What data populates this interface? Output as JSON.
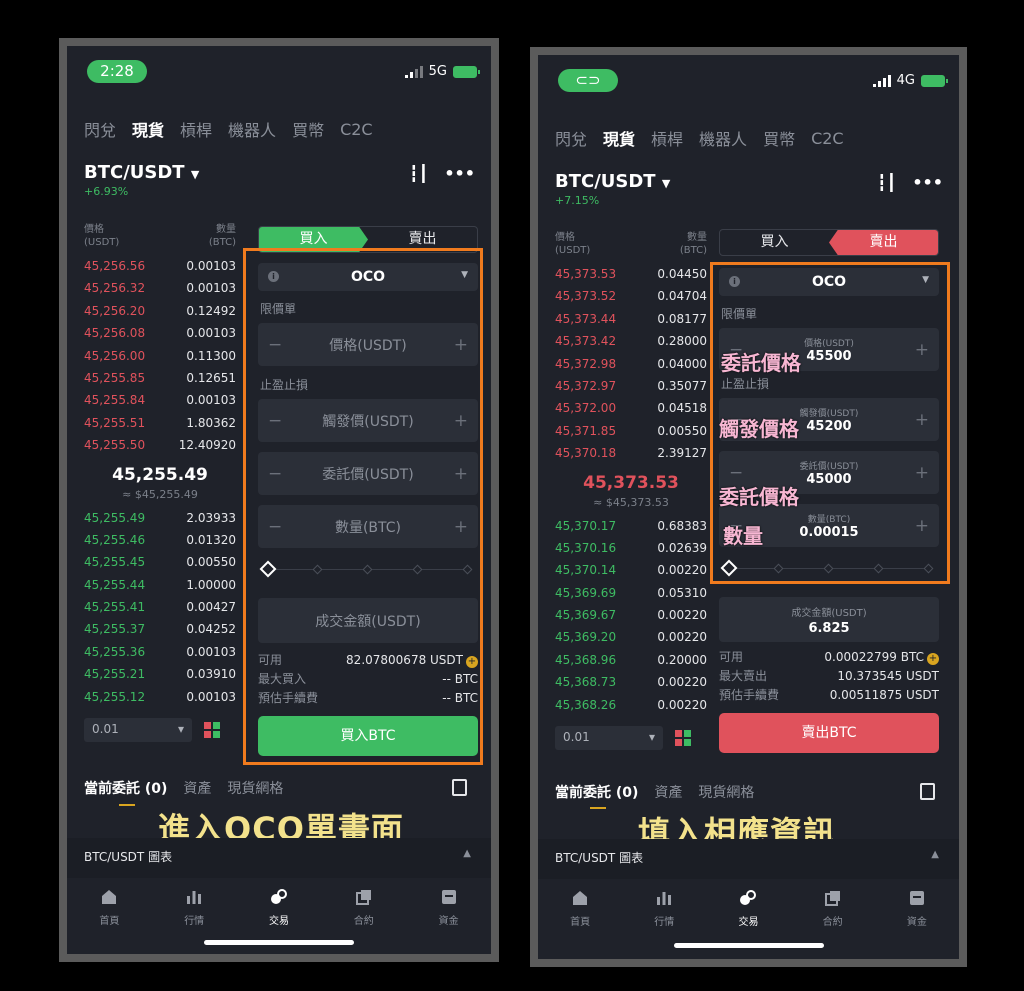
{
  "left": {
    "status": {
      "time": "2:28",
      "network": "5G"
    },
    "tabs": [
      "閃兌",
      "現貨",
      "槓桿",
      "機器人",
      "買幣",
      "C2C"
    ],
    "pair": {
      "name": "BTC/USDT",
      "change": "+6.93%"
    },
    "orderbook": {
      "head_price": "價格",
      "head_price_unit": "(USDT)",
      "head_qty": "數量",
      "head_qty_unit": "(BTC)",
      "asks": [
        [
          "45,256.56",
          "0.00103"
        ],
        [
          "45,256.32",
          "0.00103"
        ],
        [
          "45,256.20",
          "0.12492"
        ],
        [
          "45,256.08",
          "0.00103"
        ],
        [
          "45,256.00",
          "0.11300"
        ],
        [
          "45,255.85",
          "0.12651"
        ],
        [
          "45,255.84",
          "0.00103"
        ],
        [
          "45,255.51",
          "1.80362"
        ],
        [
          "45,255.50",
          "12.40920"
        ]
      ],
      "last_price": "45,255.49",
      "last_price_fiat": "≈ $45,255.49",
      "bids": [
        [
          "45,255.49",
          "2.03933"
        ],
        [
          "45,255.46",
          "0.01320"
        ],
        [
          "45,255.45",
          "0.00550"
        ],
        [
          "45,255.44",
          "1.00000"
        ],
        [
          "45,255.41",
          "0.00427"
        ],
        [
          "45,255.37",
          "0.04252"
        ],
        [
          "45,255.36",
          "0.00103"
        ],
        [
          "45,255.21",
          "0.03910"
        ],
        [
          "45,255.12",
          "0.00103"
        ]
      ],
      "precision": "0.01"
    },
    "trade": {
      "buy_label": "買入",
      "sell_label": "賣出",
      "order_type": "OCO",
      "limit_label": "限價單",
      "price_placeholder": "價格(USDT)",
      "tpsl_label": "止盈止損",
      "trigger_placeholder": "觸發價(USDT)",
      "entrust_placeholder": "委託價(USDT)",
      "qty_placeholder": "數量(BTC)",
      "amount_placeholder": "成交金額(USDT)",
      "available_label": "可用",
      "available_value": "82.07800678 USDT",
      "max_label": "最大買入",
      "max_value": "-- BTC",
      "fee_label": "預估手續費",
      "fee_value": "-- BTC",
      "action": "買入BTC"
    },
    "orders_tabs": [
      "當前委託 (0)",
      "資產",
      "現貨網格"
    ],
    "caption": "進入OCO單畫面",
    "chart_label": "BTC/USDT 圖表",
    "nav": [
      "首頁",
      "行情",
      "交易",
      "合約",
      "資金"
    ]
  },
  "right": {
    "status": {
      "network": "4G"
    },
    "tabs": [
      "閃兌",
      "現貨",
      "槓桿",
      "機器人",
      "買幣",
      "C2C"
    ],
    "pair": {
      "name": "BTC/USDT",
      "change": "+7.15%"
    },
    "orderbook": {
      "head_price": "價格",
      "head_price_unit": "(USDT)",
      "head_qty": "數量",
      "head_qty_unit": "(BTC)",
      "asks": [
        [
          "45,373.53",
          "0.04450"
        ],
        [
          "45,373.52",
          "0.04704"
        ],
        [
          "45,373.44",
          "0.08177"
        ],
        [
          "45,373.42",
          "0.28000"
        ],
        [
          "45,372.98",
          "0.04000"
        ],
        [
          "45,372.97",
          "0.35077"
        ],
        [
          "45,372.00",
          "0.04518"
        ],
        [
          "45,371.85",
          "0.00550"
        ],
        [
          "45,370.18",
          "2.39127"
        ]
      ],
      "last_price": "45,373.53",
      "last_price_fiat": "≈ $45,373.53",
      "bids": [
        [
          "45,370.17",
          "0.68383"
        ],
        [
          "45,370.16",
          "0.02639"
        ],
        [
          "45,370.14",
          "0.00220"
        ],
        [
          "45,369.69",
          "0.05310"
        ],
        [
          "45,369.67",
          "0.00220"
        ],
        [
          "45,369.20",
          "0.00220"
        ],
        [
          "45,368.96",
          "0.20000"
        ],
        [
          "45,368.73",
          "0.00220"
        ],
        [
          "45,368.26",
          "0.00220"
        ]
      ],
      "precision": "0.01"
    },
    "trade": {
      "buy_label": "買入",
      "sell_label": "賣出",
      "order_type": "OCO",
      "limit_label": "限價單",
      "price_placeholder": "價格(USDT)",
      "price_value": "45500",
      "tpsl_label": "止盈止損",
      "trigger_placeholder": "觸發價(USDT)",
      "trigger_value": "45200",
      "entrust_placeholder": "委託價(USDT)",
      "entrust_value": "45000",
      "qty_placeholder": "數量(BTC)",
      "qty_value": "0.00015",
      "amount_placeholder": "成交金額(USDT)",
      "amount_value": "6.825",
      "available_label": "可用",
      "available_value": "0.00022799 BTC",
      "max_label": "最大賣出",
      "max_value": "10.373545 USDT",
      "fee_label": "預估手續費",
      "fee_value": "0.00511875 USDT",
      "action": "賣出BTC"
    },
    "annotations": [
      "委託價格",
      "觸發價格",
      "委託價格",
      "數量"
    ],
    "orders_tabs": [
      "當前委託 (0)",
      "資產",
      "現貨網格"
    ],
    "caption": "填入相應資訊",
    "chart_label": "BTC/USDT 圖表",
    "nav": [
      "首頁",
      "行情",
      "交易",
      "合約",
      "資金"
    ]
  },
  "colors": {
    "green": "#3ebc63",
    "red": "#e0525c",
    "highlight": "#f07b1e",
    "caption": "#f3e28c"
  }
}
